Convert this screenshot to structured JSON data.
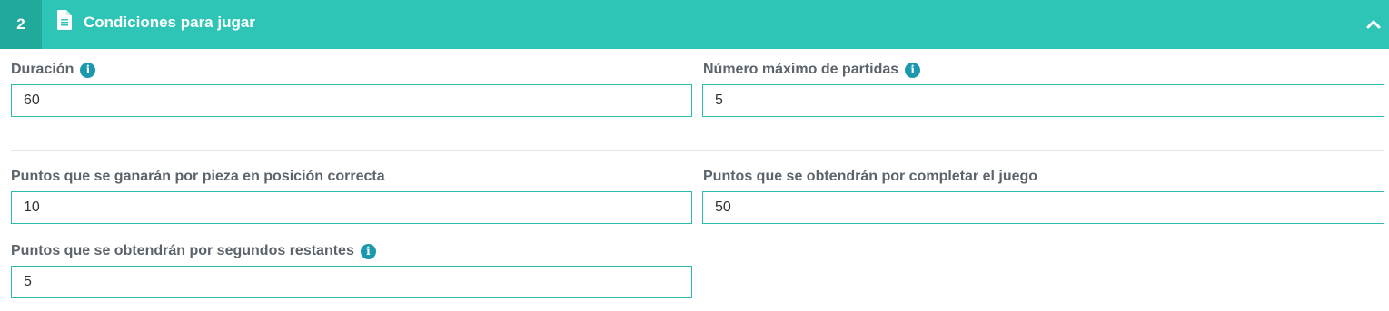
{
  "section": {
    "step": "2",
    "title": "Condiciones para jugar",
    "icon": "document-icon",
    "collapse_icon": "chevron-up-icon"
  },
  "fields": {
    "duration": {
      "label": "Duración",
      "value": "60",
      "info": "i"
    },
    "max_games": {
      "label": "Número máximo de partidas",
      "value": "5",
      "info": "i"
    },
    "points_piece": {
      "label": "Puntos que se ganarán por pieza en posición correcta",
      "value": "10"
    },
    "points_complete": {
      "label": "Puntos que se obtendrán por completar el juego",
      "value": "50"
    },
    "points_seconds": {
      "label": "Puntos que se obtendrán por segundos restantes",
      "value": "5",
      "info": "i"
    }
  },
  "colors": {
    "accent": "#2ec5b6",
    "accent_dark": "#21a99b",
    "info": "#1a98ad"
  }
}
